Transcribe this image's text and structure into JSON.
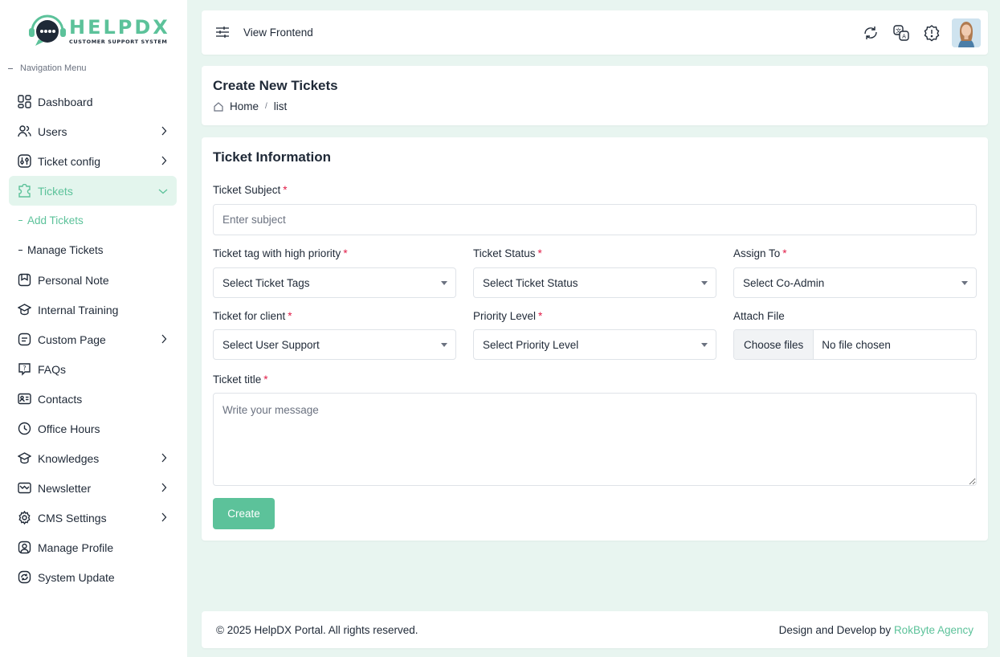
{
  "brand": {
    "name": "HELPDX",
    "tagline": "CUSTOMER SUPPORT SYSTEM",
    "accent": "#5cc29a"
  },
  "sidebar": {
    "heading": "Navigation Menu",
    "items": [
      {
        "label": "Dashboard",
        "icon": "dashboard-icon"
      },
      {
        "label": "Users",
        "icon": "users-icon"
      },
      {
        "label": "Ticket config",
        "icon": "ticket-config-icon"
      },
      {
        "label": "Tickets",
        "icon": "tickets-icon"
      },
      {
        "label": "Personal Note",
        "icon": "note-icon"
      },
      {
        "label": "Internal Training",
        "icon": "training-icon"
      },
      {
        "label": "Custom Page",
        "icon": "page-icon"
      },
      {
        "label": "FAQs",
        "icon": "faq-icon"
      },
      {
        "label": "Contacts",
        "icon": "contacts-icon"
      },
      {
        "label": "Office Hours",
        "icon": "clock-icon"
      },
      {
        "label": "Knowledges",
        "icon": "knowledge-icon"
      },
      {
        "label": "Newsletter",
        "icon": "newsletter-icon"
      },
      {
        "label": "CMS Settings",
        "icon": "gear-icon"
      },
      {
        "label": "Manage Profile",
        "icon": "profile-icon"
      },
      {
        "label": "System Update",
        "icon": "update-icon"
      }
    ],
    "sub_items": [
      {
        "label": "Add Tickets"
      },
      {
        "label": "Manage Tickets"
      }
    ]
  },
  "topbar": {
    "view_frontend": "View Frontend"
  },
  "page": {
    "title": "Create New Tickets",
    "breadcrumb_home": "Home",
    "breadcrumb_sep": "/",
    "breadcrumb_current": "list"
  },
  "form": {
    "section_title": "Ticket Information",
    "subject_label": "Ticket Subject",
    "subject_placeholder": "Enter subject",
    "tag_label": "Ticket tag with high priority",
    "tag_value": "Select Ticket Tags",
    "status_label": "Ticket Status",
    "status_value": "Select Ticket Status",
    "assign_label": "Assign To",
    "assign_value": "Select Co-Admin",
    "client_label": "Ticket for client",
    "client_value": "Select User Support",
    "priority_label": "Priority Level",
    "priority_value": "Select Priority Level",
    "file_label": "Attach File",
    "file_button": "Choose files",
    "file_status": "No file chosen",
    "title_label": "Ticket title",
    "title_placeholder": "Write your message",
    "required_mark": "*",
    "submit": "Create"
  },
  "footer": {
    "copyright": "© 2025 HelpDX Portal. All rights reserved.",
    "credit_prefix": "Design and Develop by",
    "credit_link": "RokByte Agency"
  }
}
